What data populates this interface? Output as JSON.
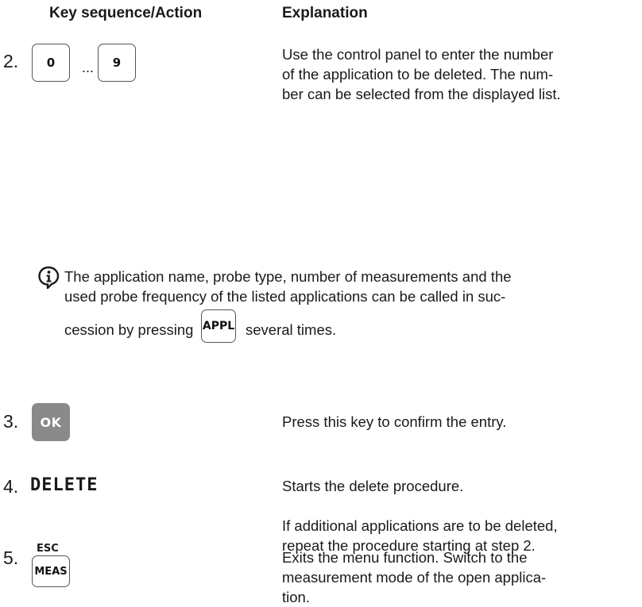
{
  "header": {
    "col1": "Key sequence/Action",
    "col2": "Explanation"
  },
  "step2": {
    "number": "2.",
    "key_start": "0",
    "ellipsis": "...",
    "key_end": "9",
    "text": [
      "Use the control panel to enter the number",
      "of the application to be deleted. The num-",
      "ber can be selected from the displayed list."
    ]
  },
  "note": {
    "icon": "info-icon",
    "lines": [
      "The application name, probe type, number of measurements and the",
      "used probe frequency of the listed applications can be called in suc-"
    ],
    "before_key": "cession by pressing",
    "key": "APPL",
    "after_key": "several times."
  },
  "step3": {
    "number": "3.",
    "key": "OK",
    "text": "Press this key to confirm the entry."
  },
  "step4": {
    "number": "4.",
    "display": "DELETE",
    "text": "Starts the delete procedure.",
    "extra": [
      "If additional applications are to be deleted,",
      "repeat the procedure starting at step 2."
    ]
  },
  "step5": {
    "number": "5.",
    "key_top": "ESC",
    "key": "MEAS",
    "text": [
      "Exits the menu function. Switch to the",
      "measurement mode of the open applica-",
      "tion."
    ]
  }
}
